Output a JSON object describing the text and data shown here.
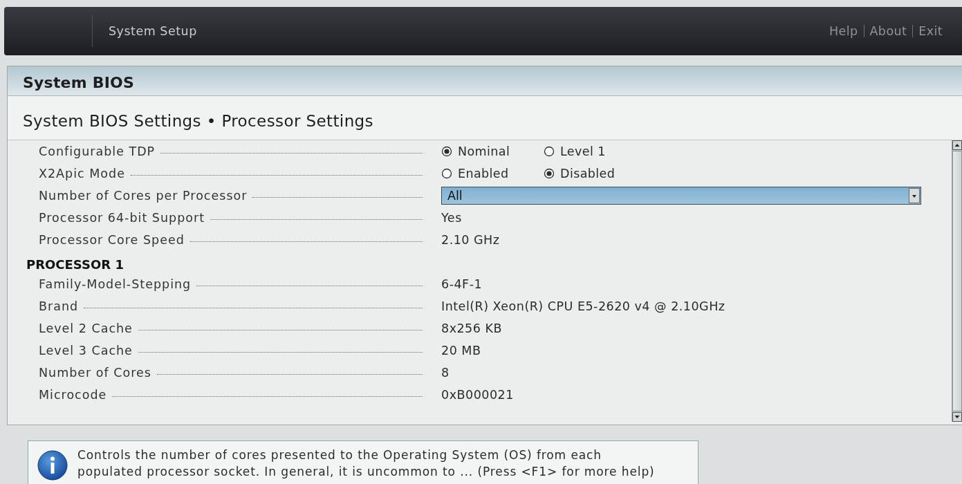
{
  "header": {
    "title": "System Setup",
    "links": [
      "Help",
      "About",
      "Exit"
    ]
  },
  "page": {
    "title": "System BIOS",
    "breadcrumb": "System BIOS Settings • Processor Settings"
  },
  "settings": [
    {
      "kind": "radio",
      "label": "Configurable TDP",
      "options": [
        {
          "label": "Nominal",
          "selected": true
        },
        {
          "label": "Level 1",
          "selected": false
        }
      ]
    },
    {
      "kind": "radio",
      "label": "X2Apic Mode",
      "options": [
        {
          "label": "Enabled",
          "selected": false
        },
        {
          "label": "Disabled",
          "selected": true
        }
      ]
    },
    {
      "kind": "dropdown",
      "label": "Number of Cores per Processor",
      "value": "All"
    },
    {
      "kind": "info",
      "label": "Processor 64-bit Support",
      "value": "Yes"
    },
    {
      "kind": "info",
      "label": "Processor Core Speed",
      "value": "2.10 GHz"
    },
    {
      "kind": "section",
      "label": "PROCESSOR 1"
    },
    {
      "kind": "info",
      "label": "Family-Model-Stepping",
      "value": "6-4F-1"
    },
    {
      "kind": "info",
      "label": "Brand",
      "value": "Intel(R) Xeon(R) CPU E5-2620 v4 @ 2.10GHz"
    },
    {
      "kind": "info",
      "label": "Level 2 Cache",
      "value": "8x256 KB"
    },
    {
      "kind": "info",
      "label": "Level 3 Cache",
      "value": "20 MB"
    },
    {
      "kind": "info",
      "label": "Number of Cores",
      "value": "8"
    },
    {
      "kind": "info",
      "label": "Microcode",
      "value": "0xB000021"
    }
  ],
  "help": {
    "text": "Controls the number of cores presented to the Operating System (OS) from each populated processor socket. In general, it is uncommon to ... (Press <F1> for more help)"
  }
}
